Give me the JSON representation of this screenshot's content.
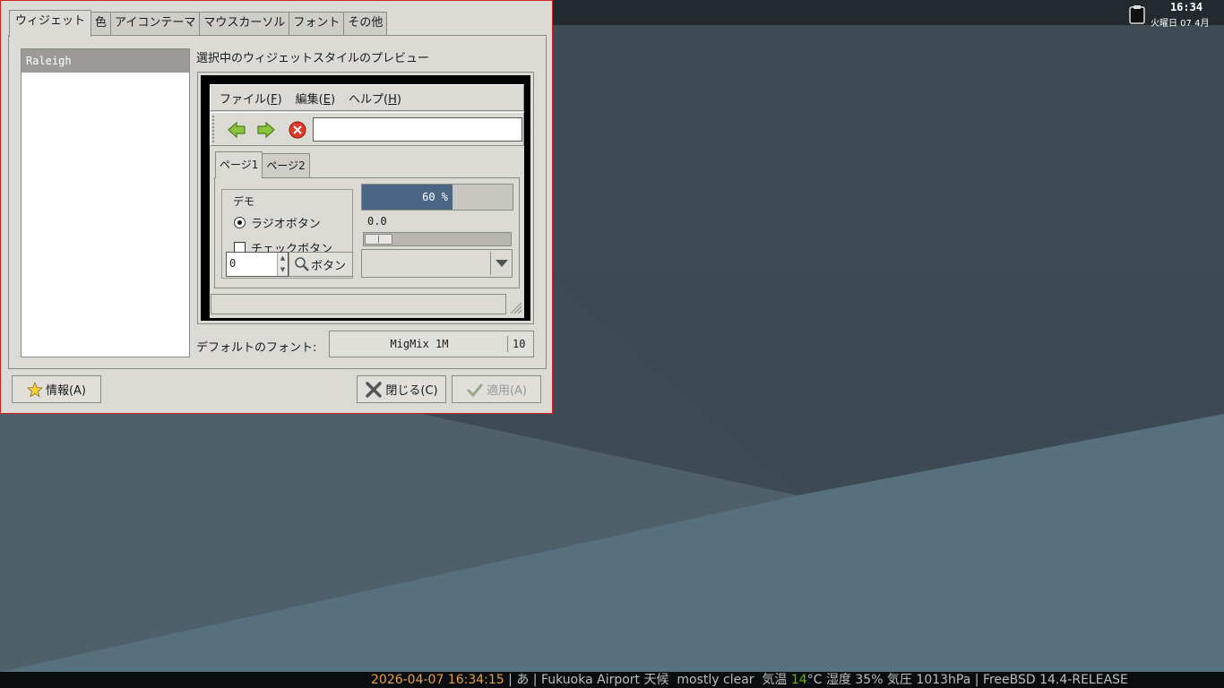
{
  "desktop": {
    "clock_time": "16:34",
    "clock_date": "火曜日 07 4月",
    "status": {
      "datetime": "2026-04-07 16:34:15",
      "sep1": " | ",
      "ime": "あ",
      "sep2": " | ",
      "weather_prefix": "Fukuoka Airport 天候  mostly clear  気温 ",
      "temp": "14",
      "weather_suffix": "°C 湿度 35% 気圧 1013hPa",
      "sep3": " | ",
      "os": "FreeBSD 14.4-RELEASE"
    }
  },
  "dialog": {
    "tabs": [
      "ウィジェット",
      "色",
      "アイコンテーマ",
      "マウスカーソル",
      "フォント",
      "その他"
    ],
    "active_tab": "ウィジェット",
    "theme_list": [
      "Raleigh"
    ],
    "preview_label": "選択中のウィジェットスタイルのプレビュー",
    "preview": {
      "menu": [
        {
          "label": "ファイル(",
          "mn": "F",
          "end": ")"
        },
        {
          "label": "編集(",
          "mn": "E",
          "end": ")"
        },
        {
          "label": "ヘルプ(",
          "mn": "H",
          "end": ")"
        }
      ],
      "toolbar_icons": [
        "back-arrow-icon",
        "forward-arrow-icon",
        "stop-icon"
      ],
      "entry_value": "",
      "tabs": [
        "ページ1",
        "ページ2"
      ],
      "frame_label": "デモ",
      "radio_label": "ラジオボタン",
      "check_label": "チェックボタン",
      "spin_value": "0",
      "button_label": "ボタン",
      "progress_text": "60 %",
      "progress_fraction": 0.6,
      "scale_value": "0.0"
    },
    "default_font_label": "デフォルトのフォント:",
    "font_name": "MigMix 1M",
    "font_size": "10",
    "buttons": {
      "about": "情報(A)",
      "close": "閉じる(C)",
      "apply": "適用(A)"
    },
    "colors": {
      "window_border": "#d02020",
      "progress_fill": "#4b6584",
      "selection": "#9c9a96"
    }
  }
}
